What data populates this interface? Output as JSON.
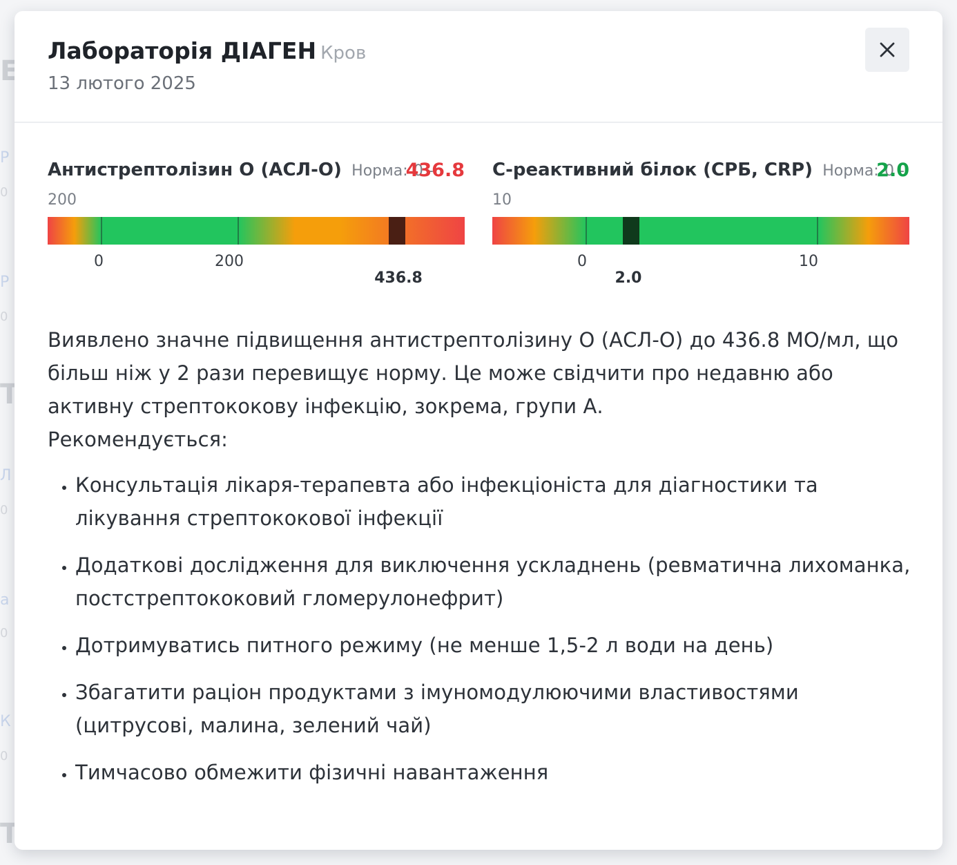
{
  "modal": {
    "title": "Лабораторія ДІАГЕН",
    "sample_type": "Кров",
    "date": "13 лютого 2025",
    "close_icon": "close-icon"
  },
  "metrics": [
    {
      "name": "Антистрептолізин О (АСЛ-О)",
      "norm_label": "Норма:",
      "norm_range": "0 - 200",
      "value_text": "436.8",
      "status": "high",
      "status_color": "#e5393d",
      "ticks": [
        "0",
        "200"
      ],
      "marker_label": "436.8"
    },
    {
      "name": "С-реактивний білок (СРБ, CRP)",
      "norm_label": "Норма:",
      "norm_range": "0 - 10",
      "value_text": "2.0",
      "status": "normal",
      "status_color": "#15a34a",
      "ticks": [
        "0",
        "10"
      ],
      "marker_label": "2.0"
    }
  ],
  "description": {
    "paragraph": "Виявлено значне підвищення антистрептолізину О (АСЛ-О) до 436.8 МО/мл, що більш ніж у 2 рази перевищує норму. Це може свідчити про недавню або активну стрептококову інфекцію, зокрема, групи А.",
    "recommend_heading": "Рекомендується:",
    "recommendations": [
      "Консультація лікаря-терапевта або інфекціоніста для діагностики та лікування стрептококової інфекції",
      "Додаткові дослідження для виключення ускладнень (ревматична лихоманка, постстрептококовий гломерулонефрит)",
      "Дотримуватись питного режиму (не менше 1,5-2 л води на день)",
      "Збагатити раціон продуктами з імуномодулюючими властивостями (цитрусові, малина, зелений чай)",
      "Тимчасово обмежити фізичні навантаження"
    ]
  },
  "colors": {
    "danger": "#e5393d",
    "warning": "#f59e0b",
    "normal": "#22c55e",
    "marker_high": "#4a1f14",
    "marker_normal": "#0f3a1c"
  }
}
